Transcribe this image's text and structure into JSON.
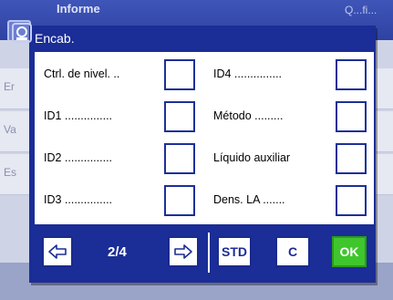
{
  "background_app": {
    "title": "Informe",
    "title_right": "Q...fi...",
    "rows": [
      "Er",
      "Va",
      "Es"
    ]
  },
  "dialog": {
    "title": "Encab.",
    "left_items": [
      {
        "label": "Ctrl. de nivel. .."
      },
      {
        "label": "ID1 ..............."
      },
      {
        "label": "ID2 ..............."
      },
      {
        "label": "ID3 ..............."
      }
    ],
    "right_items": [
      {
        "label": "ID4 ..............."
      },
      {
        "label": "Método ........."
      },
      {
        "label": "Líquido auxiliar"
      },
      {
        "label": "Dens. LA ......."
      }
    ]
  },
  "footer": {
    "page": "2/4",
    "std_label": "STD",
    "c_label": "C",
    "ok_label": "OK"
  },
  "colors": {
    "dialog": "#1b2d96",
    "ok_button": "#3fc62c",
    "background_panel": "#cfd3e6"
  }
}
